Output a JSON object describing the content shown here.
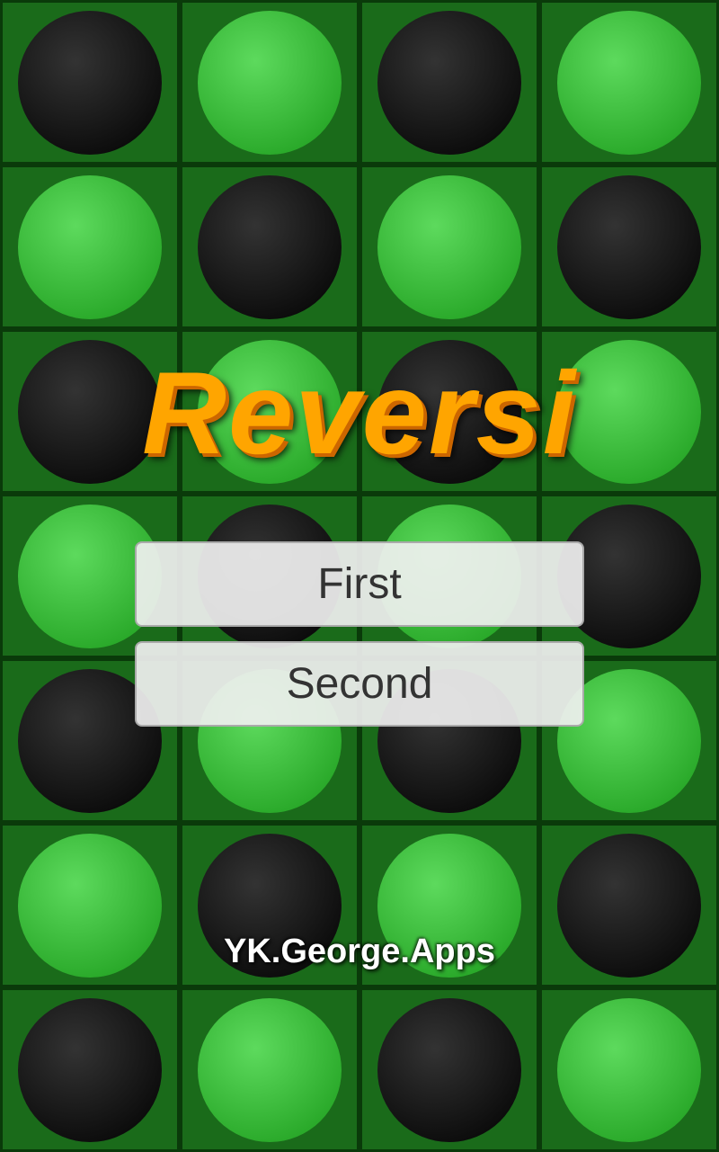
{
  "app": {
    "title": "Reversi",
    "credits": "YK.George.Apps"
  },
  "buttons": {
    "first_label": "First",
    "second_label": "Second"
  },
  "grid": {
    "cells": [
      "black",
      "green",
      "black",
      "green",
      "green",
      "black",
      "green",
      "black",
      "black",
      "green",
      "black",
      "green",
      "green",
      "black",
      "green",
      "black",
      "black",
      "green",
      "black",
      "green",
      "green",
      "black",
      "green",
      "black",
      "black",
      "green",
      "black",
      "green"
    ]
  },
  "colors": {
    "title_color": "#ffa500",
    "grid_bg": "#1a6b1a",
    "disc_black": "#000000",
    "disc_green": "#22cc22"
  }
}
